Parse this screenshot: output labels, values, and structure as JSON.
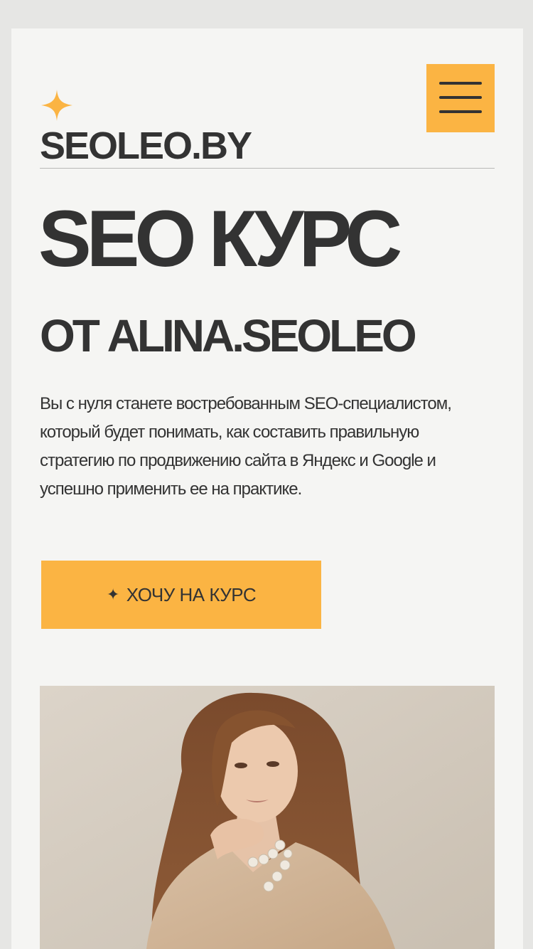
{
  "header": {
    "brand": "SEOLEO.BY",
    "logo_icon": "sparkle-star-icon",
    "menu_icon": "hamburger-menu-icon"
  },
  "hero": {
    "title": "SEO КУРС",
    "subtitle": "ОТ ALINA.SEOLEO",
    "description": "Вы с нуля станете востребованным SEO-специалистом, который будет понимать, как составить правильную стратегию по продвижению сайта в Яндекс и Google и успешно применить ее на практике.",
    "cta_icon": "✦",
    "cta_label": "ХОЧУ НА КУРС"
  },
  "photo": {
    "subject": "portrait-photo"
  },
  "colors": {
    "accent": "#fbb443",
    "text": "#333333",
    "card_background": "#f5f5f3",
    "page_background": "#e6e6e4"
  }
}
